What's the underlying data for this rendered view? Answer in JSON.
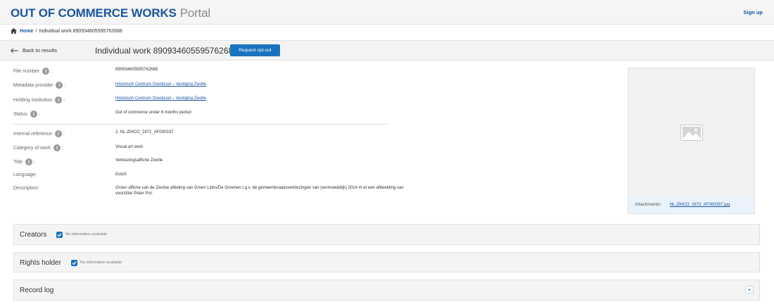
{
  "header": {
    "logo_main": "OUT OF COMMERCE WORKS",
    "logo_sub": "Portal",
    "signup": "Sign up"
  },
  "breadcrumb": {
    "home": "Home",
    "separator": "/",
    "current": "Individual work 890934605595762688"
  },
  "toolbar": {
    "back_label": "Back to results",
    "title": "Individual work 890934605595762688",
    "optout_label": "Request opt-out"
  },
  "fields": {
    "file_number": {
      "label": "File number",
      "value": "890934605595762688"
    },
    "metadata_provider": {
      "label": "Metadata provider",
      "value": "Historisch Centrum Overijssel – Vestiging Zwolle"
    },
    "holding_institution": {
      "label": "Holding institution",
      "value": "Historisch Centrum Overijssel – Vestiging Zwolle"
    },
    "status": {
      "label": "Status",
      "value": "Out of commerce under 6 months period"
    },
    "internal_reference": {
      "label": "Internal reference",
      "value": "2. NL-ZlHCO_1672_AF000337"
    },
    "category": {
      "label": "Category of work",
      "value": "Visual art work"
    },
    "title": {
      "label": "Title",
      "value": "Verkiezingsaffiche Zwolle"
    },
    "language": {
      "label": "Language:",
      "value": "Dutch"
    },
    "description": {
      "label": "Description:",
      "value": "Groen affiche van de Zwolse afdeling van Groen Links/De Groenen t.g.v. de gemeenteraadsverkiezingen van (vermoedelijk) 2014 m et een afbeelding van voorzitter Peter Pot."
    }
  },
  "colon": ":",
  "info_glyph": "i",
  "attachments": {
    "label": "Attachments:",
    "file": "NL-ZlHCO_1672_AF000337.jpg"
  },
  "panels": {
    "creators": {
      "title": "Creators",
      "checkbox_label": "No information available"
    },
    "rights_holder": {
      "title": "Rights holder",
      "checkbox_label": "No information available"
    },
    "record_log": {
      "title": "Record log"
    }
  },
  "colors": {
    "brand": "#1a56a0",
    "button": "#1a73bf",
    "panel_bg": "#f4f4f4"
  },
  "icons": [
    "home-icon",
    "arrow-left-icon",
    "info-icon",
    "image-placeholder-icon",
    "checkbox-checked-icon",
    "chevron-down-icon"
  ]
}
